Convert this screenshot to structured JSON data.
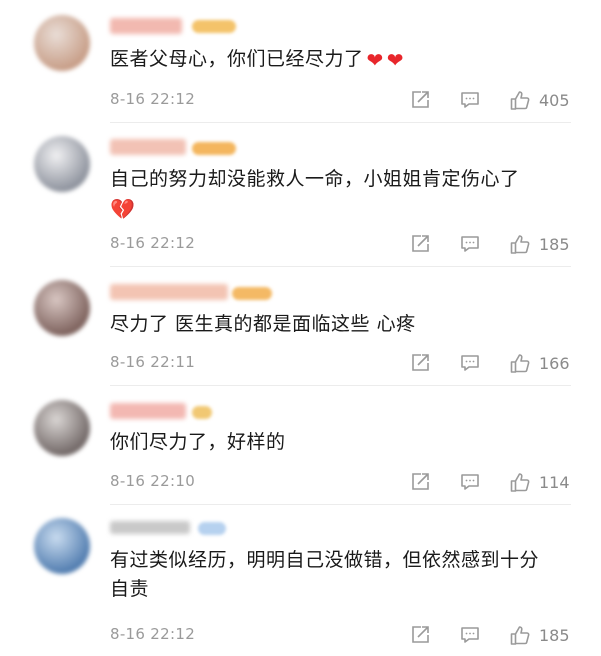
{
  "comments": [
    {
      "text": "医者父母心，你们已经尽力了",
      "emojis": [
        "❤",
        "❤"
      ],
      "emoji_kind": "heart",
      "time": "8-16 22:12",
      "likes": "405",
      "avatar_colors": [
        "#e9ddd6",
        "#c69b84"
      ],
      "name_color": "#f2b9b0",
      "badge_color": "#f4c36a"
    },
    {
      "text": "自己的努力却没能救人一命，小姐姐肯定伤心了",
      "emojis": [
        "💔"
      ],
      "emoji_kind": "broken",
      "time": "8-16 22:12",
      "likes": "185",
      "avatar_colors": [
        "#f0f0f2",
        "#8a8f9a"
      ],
      "name_color": "#f2c2b5",
      "badge_color": "#f4b65e"
    },
    {
      "text": "尽力了 医生真的都是面临这些 心疼",
      "emojis": [],
      "time": "8-16 22:11",
      "likes": "166",
      "avatar_colors": [
        "#d8c6c2",
        "#7a5e59"
      ],
      "name_color": "#f3c4b3",
      "badge_color": "#f4b965"
    },
    {
      "text": "你们尽力了，好样的",
      "emojis": [],
      "time": "8-16 22:10",
      "likes": "114",
      "avatar_colors": [
        "#d9d5d3",
        "#6e6463"
      ],
      "name_color": "#f3b8b2",
      "badge_color": "#f1c873"
    },
    {
      "text": "有过类似经历，明明自己没做错，但依然感到十分自责",
      "emojis": [],
      "time": "8-16 22:12",
      "likes": "185",
      "avatar_colors": [
        "#c8dbef",
        "#4d79ad"
      ],
      "name_color": "#c9c9c9",
      "badge_color": "#b6d1ef"
    }
  ]
}
